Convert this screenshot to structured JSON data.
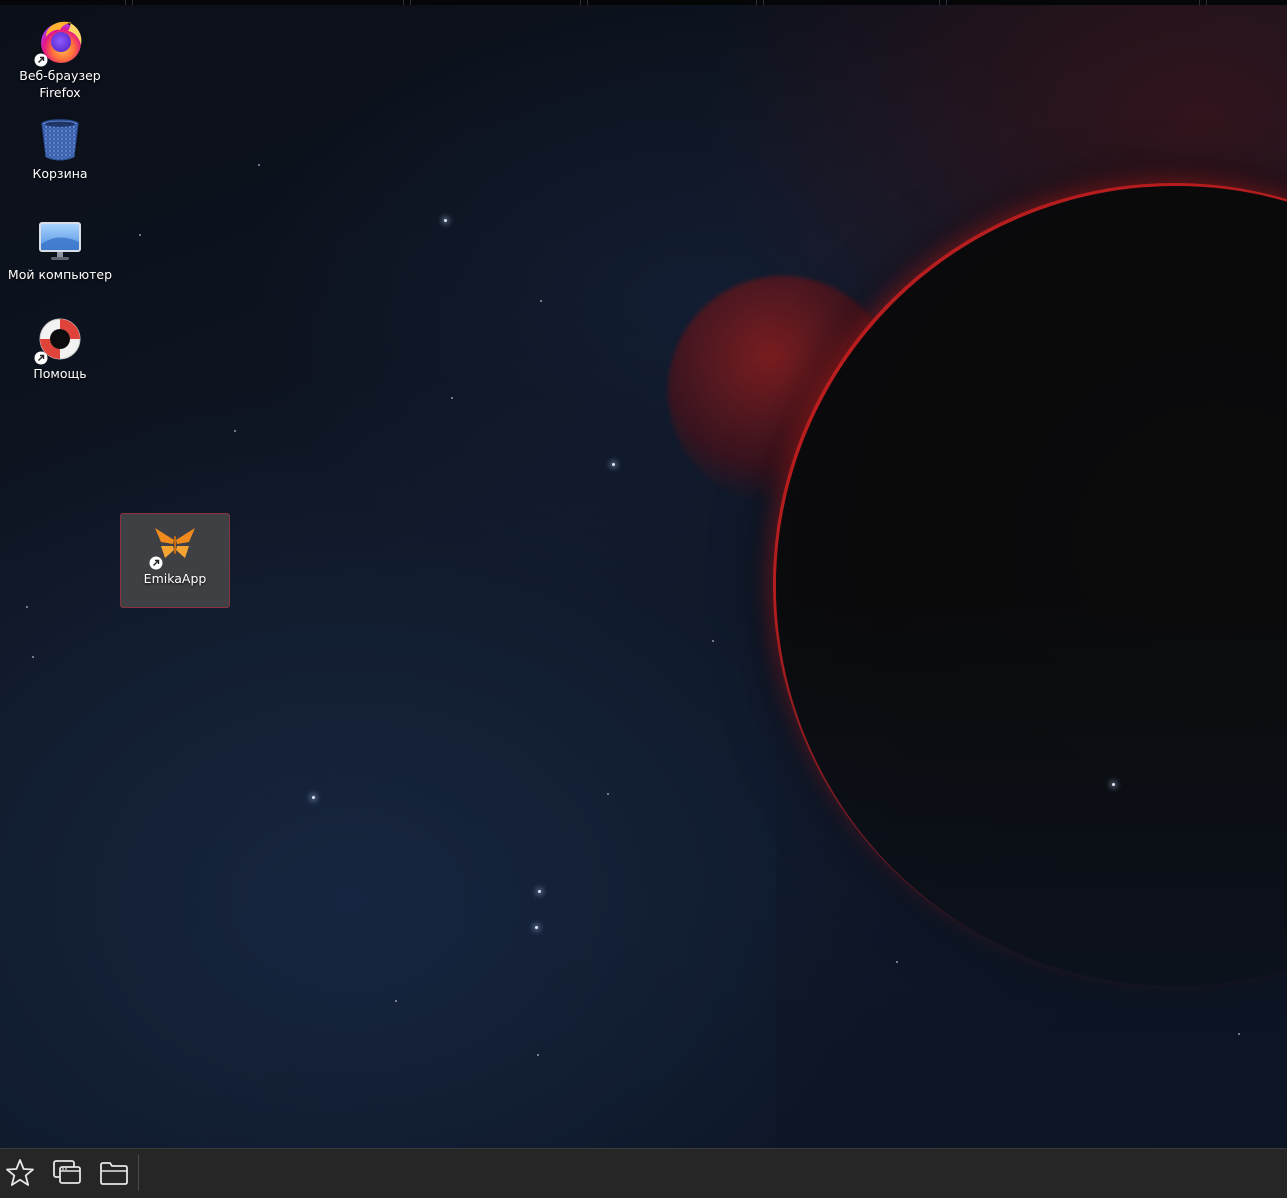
{
  "desktop": {
    "icons": [
      {
        "label": "Веб-браузер Firefox",
        "icon": "firefox-icon",
        "shortcut": true
      },
      {
        "label": "Корзина",
        "icon": "trash-icon",
        "shortcut": false
      },
      {
        "label": "Мой компьютер",
        "icon": "computer-icon",
        "shortcut": false
      },
      {
        "label": "Помощь",
        "icon": "help-lifebuoy-icon",
        "shortcut": true
      },
      {
        "label": "EmikaApp",
        "icon": "emika-butterfly-icon",
        "shortcut": true,
        "selected": true
      }
    ]
  },
  "taskbar": {
    "buttons": [
      {
        "icon": "star-menu-icon"
      },
      {
        "icon": "window-switcher-icon"
      },
      {
        "icon": "folder-icon"
      }
    ]
  },
  "colors": {
    "accent_red": "#c81e1e",
    "selection_border": "#8a3340",
    "taskbar_bg": "#262626",
    "emika_orange": "#f08a1c"
  }
}
